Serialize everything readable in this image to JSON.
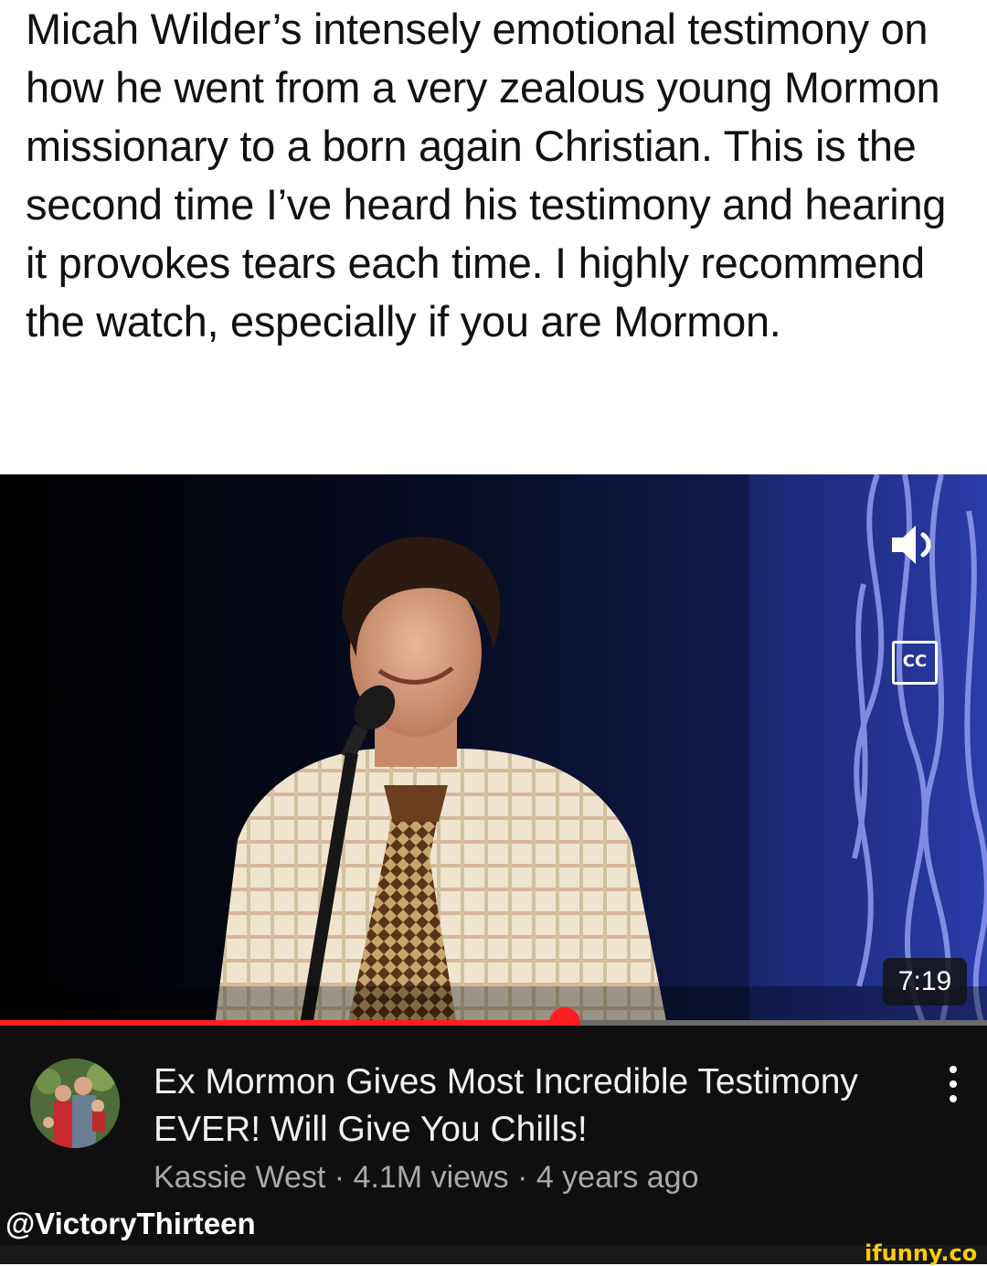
{
  "post": {
    "caption": "Micah Wilder’s intensely emotional testimony on how he went from a very zealous young Mormon missionary to a born again Christian. This is the second time I’ve heard his testimony and hearing it provokes tears each time. I highly recommend the watch, especially if you are Mormon."
  },
  "player": {
    "volume_icon": "speaker-volume-icon",
    "cc_label": "CC",
    "duration": "7:19",
    "progress_fraction": 0.572,
    "accent_color": "#ff1e1e"
  },
  "video": {
    "title": "Ex Mormon Gives Most Incredible Testimony EVER! Will Give You Chills!",
    "channel": "Kassie West",
    "views": "4.1M views",
    "age": "4 years ago",
    "meta_separator": " · ",
    "more_icon": "vertical-ellipsis-icon"
  },
  "attribution": {
    "handle": "@VictoryThirteen",
    "watermark": "ifunny.co"
  }
}
